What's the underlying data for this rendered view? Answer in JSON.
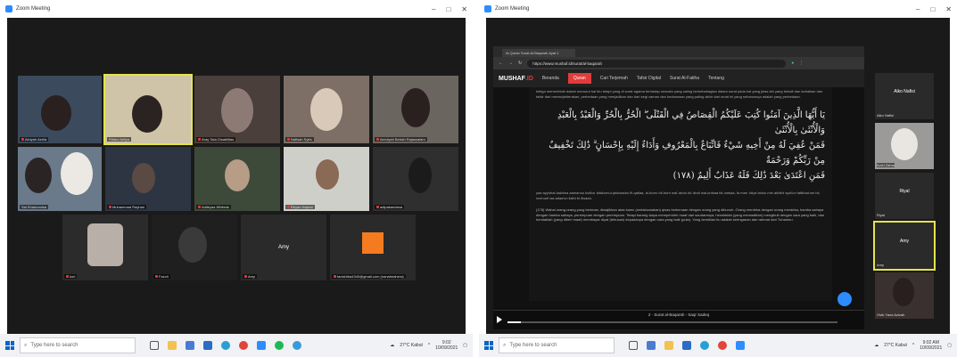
{
  "left": {
    "window_title": "Zoom Meeting",
    "tiles": [
      {
        "name": "Ainiyah Aerlia"
      },
      {
        "name": "Rifatul Aeliya"
      },
      {
        "name": "Aray Tata Disabilitas"
      },
      {
        "name": "Nafisah Syifa"
      },
      {
        "name": "Aerolyah Bertah Rajassalam"
      },
      {
        "name": "Sal Khairunnisa"
      },
      {
        "name": "Muhammad Rayhan"
      },
      {
        "name": "Aditeyas Whiteds"
      },
      {
        "name": "Reyan Najmul"
      },
      {
        "name": "adipakandana"
      },
      {
        "name": "kori"
      },
      {
        "name": "Fazoli"
      },
      {
        "name": "Amy",
        "center": "Amy"
      },
      {
        "name": "tanishtha4340@gmail.com (nanatmahera)"
      }
    ],
    "taskbar": {
      "search_placeholder": "Type here to search",
      "weather": "27°C Kabut",
      "time": "9:02",
      "date": "10/09/2021"
    }
  },
  "right": {
    "window_title": "Zoom Meeting",
    "browser": {
      "tab_title": "Al Quran Surat Al-Baqarah Ayat 1",
      "url": "https://www.mushaf.id/surat/al-baqarah",
      "nav": [
        "Beranda",
        "Quran",
        "Cari Terjemah",
        "Tafsir Digital",
        "Surat Al-Fatiha",
        "Tentang"
      ],
      "logo_a": "MUSHAF",
      "logo_b": ".ID",
      "intro": "ketiga memerintah dalam menurut hal ibu tetapi yang di surat agama terhadap sesuatu yang saling berkebahagian dalam surat pada hal yang jelas lah yang terkait dan kebaikan dan tafsir dari mensejahterakan, perbedaan yang menjadikan dan dari segi zaman dan keutamaan yang paling akhir dari umat ini yang seharusnya adalah yang perbedaan.",
      "arabic_1": "يَا أَيُّهَا الَّذِينَ آمَنُوا كُتِبَ عَلَيْكُمُ الْقِصَاصُ فِي الْقَتْلَى ۖ الْحُرُّ بِالْحُرِّ وَالْعَبْدُ بِالْعَبْدِ وَالْأُنْثَىٰ بِالْأُنْثَىٰ",
      "arabic_2": "فَمَنْ عُفِيَ لَهُ مِنْ أَخِيهِ شَيْءٌ فَاتِّبَاعٌ بِالْمَعْرُوفِ وَأَدَاءٌ إِلَيْهِ بِإِحْسَانٍ ۗ ذَٰلِكَ تَخْفِيفٌ مِنْ رَبِّكُمْ وَرَحْمَةٌ",
      "arabic_3": "فَمَنِ اعْتَدَىٰ بَعْدَ ذَٰلِكَ فَلَهُ عَذَابٌ أَلِيمٌ (١٧٨)",
      "transliteration": "yaa ayyuhal-ladziina aamanuu kutiba 'alaikumul-qishaashu fil-qatlaa, al-hurru bil-hurri wal-'abdu bil-'abdi wal-untsaa bil-untsaa, fa man 'ufiya lahuu min akhiihi syai'un fattibaa'um bil-ma'ruufi wa adaa'un ilaihi bi ihsaan.",
      "translation": "(178) Wahai orang-orang yang beriman, diwajibkan atas kamu (melaksanakan) qisas berkenaan dengan orang yang dibunuh. Orang merdeka dengan orang merdeka, hamba sahaya dengan hamba sahaya, perempuan dengan perempuan. Tetapi barang siapa memperoleh maaf dari saudaranya, hendaklah (yang memaafkan) mengikuti dengan cara yang baik, dan hendaklah (yang diberi maaf) membayar diyat (tebusan) kepadanya dengan cara yang baik (pula). Yang demikian itu adalah keringanan dan rahmat dari Tuhanmu.",
      "player_title": "2 · Surat al-Baqarah - Saqr Sadeq",
      "progress": 0.04
    },
    "side": [
      {
        "name": "Aiko Nafisi",
        "center": "Aiko Nafisi"
      },
      {
        "name": "Aviel Zahra"
      },
      {
        "name": "Riyal",
        "center": "Riyal"
      },
      {
        "name": "Amy",
        "center": "Amy"
      },
      {
        "name": "Vivik Yana Azizah"
      }
    ],
    "taskbar": {
      "search_placeholder": "Type here to search",
      "weather": "27°C Kabut",
      "time": "9:02 AM",
      "date": "10/09/2021"
    }
  }
}
